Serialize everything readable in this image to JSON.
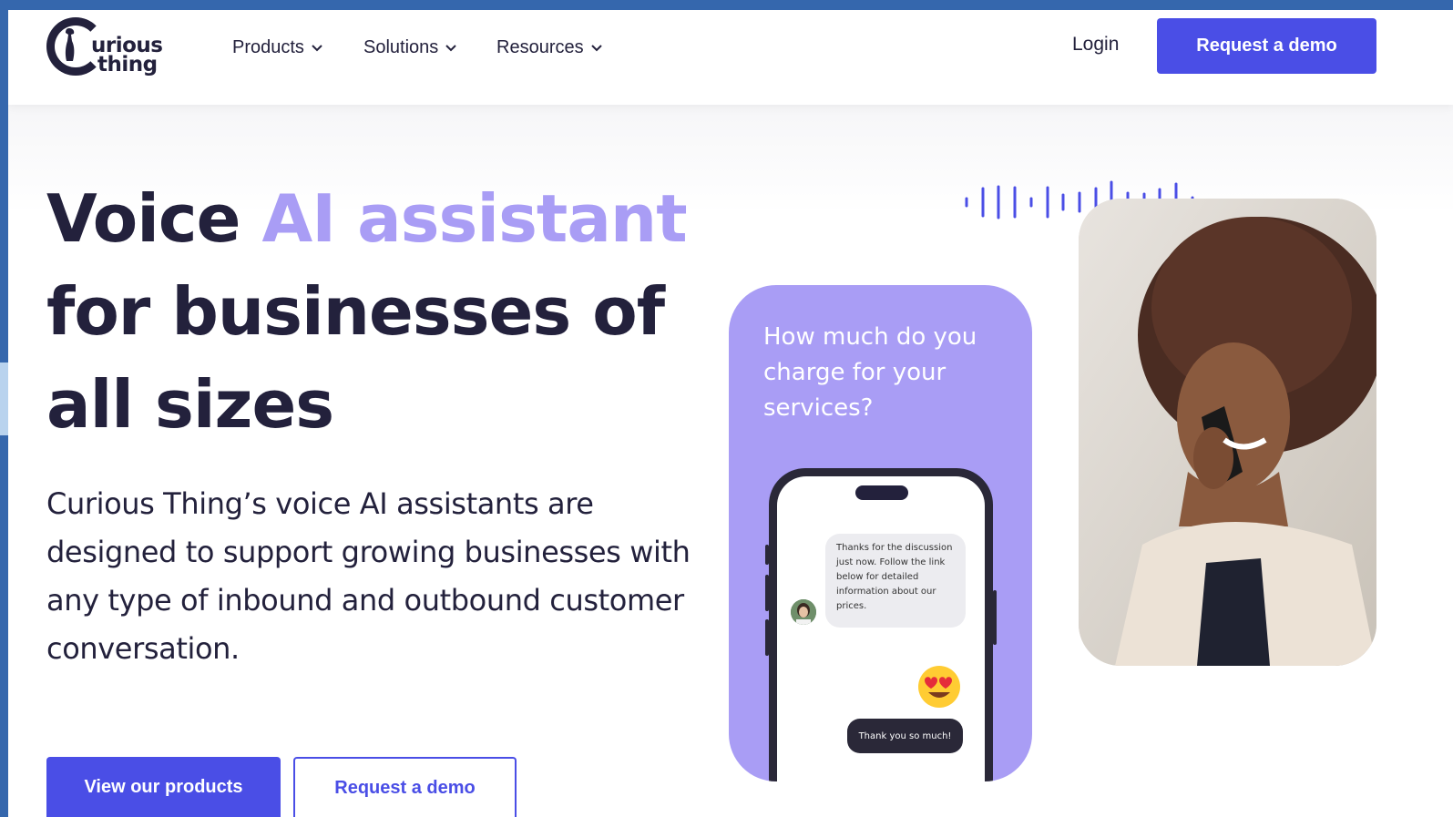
{
  "header": {
    "logo": {
      "line1": "urious",
      "line2": "thing",
      "icon": "meerkat-logo-icon"
    },
    "nav": [
      {
        "label": "Products",
        "icon": "chevron-down-icon"
      },
      {
        "label": "Solutions",
        "icon": "chevron-down-icon"
      },
      {
        "label": "Resources",
        "icon": "chevron-down-icon"
      }
    ],
    "login_label": "Login",
    "demo_button_label": "Request a demo"
  },
  "hero": {
    "headline_part1": "Voice ",
    "headline_highlight": "AI assistant",
    "headline_part2": "for businesses of all sizes",
    "description": "Curious Thing’s voice AI assistants are designed to support growing businesses with any type of inbound and outbound customer conversation.",
    "primary_button_label": "View our products",
    "secondary_button_label": "Request a demo"
  },
  "visual": {
    "card_question": "How much do you charge for your services?",
    "incoming_message": "Thanks for the discussion just now. Follow the link below for detailed information about our prices.",
    "outgoing_message": "Thank you so much!",
    "emoji": "heart-eyes-emoji-icon"
  },
  "colors": {
    "brand_blue": "#4a4ee6",
    "lavender": "#a99df5",
    "dark_navy": "#23213c",
    "outer_frame": "#3567ad"
  }
}
